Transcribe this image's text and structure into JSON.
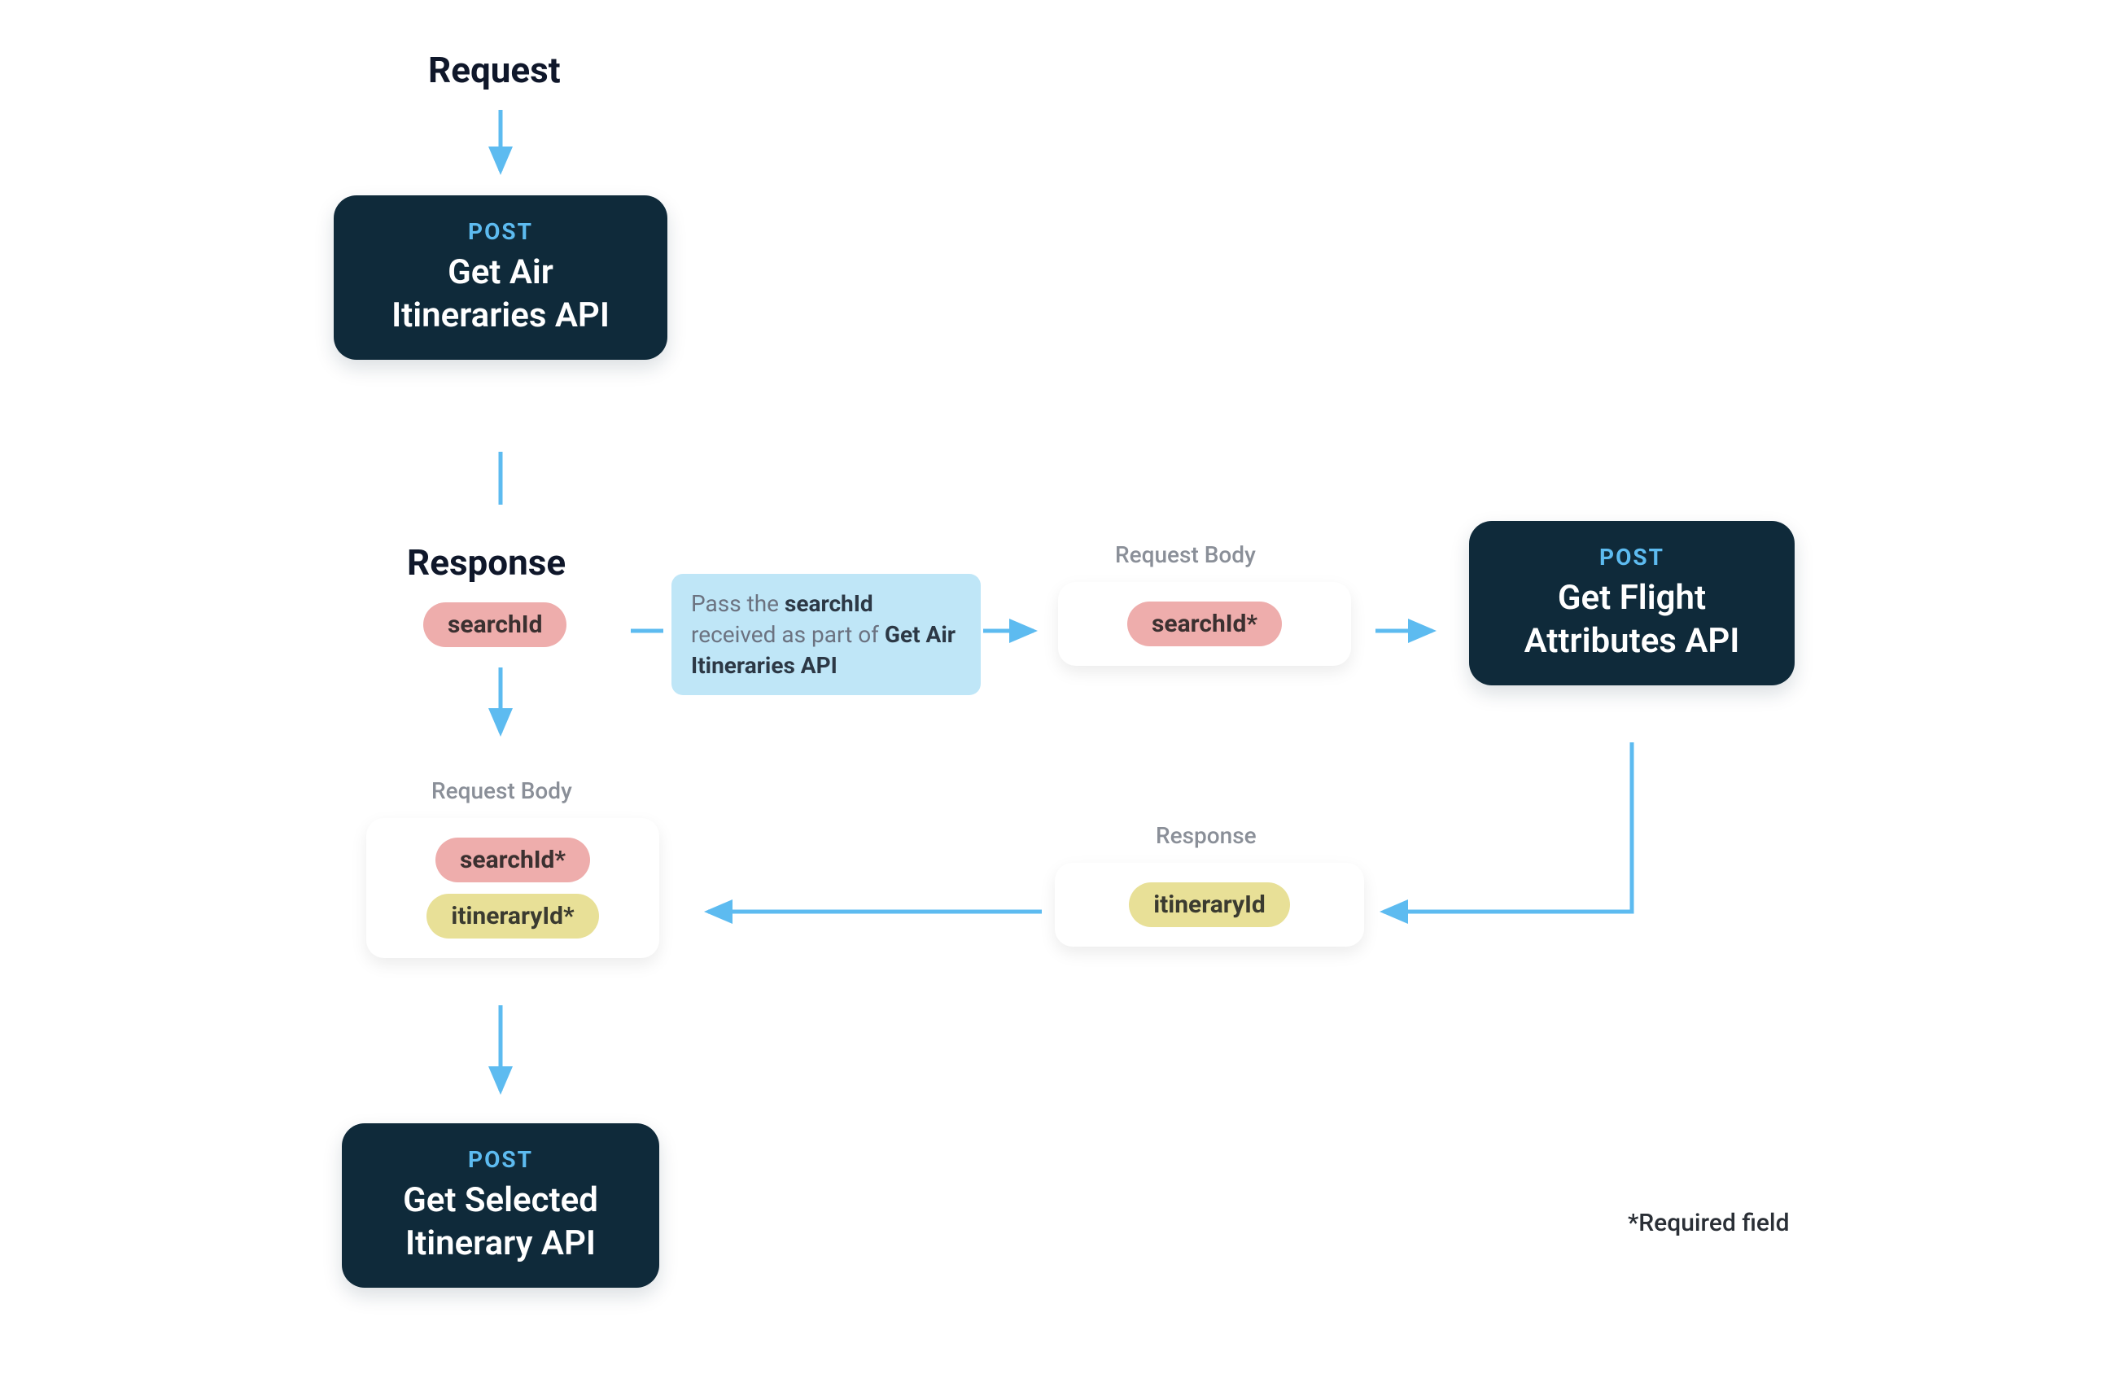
{
  "labels": {
    "request": "Request",
    "response": "Response",
    "requestBody": "Request Body",
    "footnote": "*Required field"
  },
  "apis": {
    "airItineraries": {
      "method": "POST",
      "title1": "Get Air",
      "title2": "Itineraries API"
    },
    "flightAttributes": {
      "method": "POST",
      "title1": "Get Flight",
      "title2": "Attributes API"
    },
    "selectedItinerary": {
      "method": "POST",
      "title1": "Get Selected",
      "title2": "Itinerary API"
    }
  },
  "pills": {
    "searchId": "searchId",
    "searchIdReq": "searchId*",
    "itineraryId": "itineraryId",
    "itineraryIdReq": "itineraryId*"
  },
  "info": {
    "pre": "Pass the ",
    "bold1": "searchId",
    "mid": " received as part of ",
    "bold2": "Get Air Itineraries API"
  },
  "colors": {
    "arrow": "#5dbbf0"
  }
}
